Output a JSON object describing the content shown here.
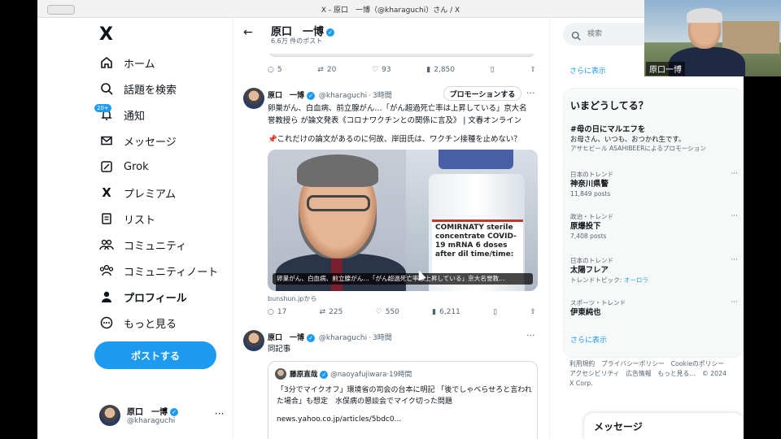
{
  "window": {
    "title": "X - 原口　一博（@kharaguchi）さん / X"
  },
  "nav": {
    "logo": "X",
    "items": [
      {
        "label": "ホーム",
        "icon": "home-icon"
      },
      {
        "label": "話題を検索",
        "icon": "search-icon"
      },
      {
        "label": "通知",
        "icon": "bell-icon",
        "badge": "20+"
      },
      {
        "label": "メッセージ",
        "icon": "mail-icon"
      },
      {
        "label": "Grok",
        "icon": "grok-icon"
      },
      {
        "label": "プレミアム",
        "icon": "x-premium-icon"
      },
      {
        "label": "リスト",
        "icon": "list-icon"
      },
      {
        "label": "コミュニティ",
        "icon": "communities-icon"
      },
      {
        "label": "コミュニティノート",
        "icon": "community-notes-icon"
      },
      {
        "label": "プロフィール",
        "icon": "profile-icon"
      },
      {
        "label": "もっと見る",
        "icon": "more-circle-icon"
      }
    ],
    "post_button": "ポストする",
    "account": {
      "name": "原口　一博",
      "handle": "@kharaguchi"
    }
  },
  "header": {
    "name": "原口　一博",
    "posts_count": "6.6万 件のポスト",
    "back": "←"
  },
  "prev_tweet_actions": {
    "replies": "5",
    "reposts": "20",
    "likes": "93",
    "views": "2,850"
  },
  "tweet1": {
    "name": "原口　一博",
    "handle": "@kharaguchi",
    "time": "3時間",
    "promote": "プロモーションする",
    "text_line1": "卵巣がん、白血病、前立腺がん…「がん超過死亡率は上昇している」京大名",
    "text_line2": "誉教授ら が論文発表《コロナワクチンとの関係に言及》 | 文春オンライン",
    "text_line3": "📌これだけの論文があるのに何故、岸田氏は、ワクチン接種を止めない？",
    "image_caption": "卵巣がん、白血病、前立腺がん…「がん超過死亡率は上昇している」京大名誉教…",
    "vial_label": "COMIRNATY sterile concentrate COVID-19 mRNA 6 doses after dil time/time:",
    "source": "bunshun.jpから",
    "actions": {
      "replies": "17",
      "reposts": "225",
      "likes": "550",
      "views": "6,211"
    }
  },
  "tweet2": {
    "name": "原口　一博",
    "handle": "@kharaguchi",
    "time": "3時間",
    "text": "同記事",
    "quote": {
      "name": "藤原直哉",
      "handle": "@naoyafujiwara",
      "time": "19時間",
      "text": "「3分でマイクオフ」環境省の司会の台本に明記 「後でしゃべらせろと言われた場合」も想定　水俣病の懇談会でマイク切った問題",
      "link": "news.yahoo.co.jp/articles/5bdc0..."
    }
  },
  "sidebar": {
    "search_placeholder": "検索",
    "show_more_top": "さらに表示",
    "trends_title": "いまどうしてる？",
    "trends": [
      {
        "category": "",
        "name": "#母の日にマルエフを",
        "count": "お母さん、いつも、おつかれ生です。",
        "extra": "アサヒビール ASAHIBEERによるプロモーション"
      },
      {
        "category": "日本のトレンド",
        "name": "神奈川県警",
        "count": "11,849 posts"
      },
      {
        "category": "政治・トレンド",
        "name": "原爆投下",
        "count": "7,408 posts"
      },
      {
        "category": "日本のトレンド",
        "name": "太陽フレア",
        "count": "トレンドトピック: ",
        "link": "オーロラ"
      },
      {
        "category": "スポーツ・トレンド",
        "name": "伊東純也",
        "count": ""
      }
    ],
    "show_more_bottom": "さらに表示",
    "footer": "利用規約　プライバシーポリシー　Cookieのポリシー　アクセシビリティ　広告情報　もっと見る…　© 2024 X Corp.",
    "messages": "メッセージ"
  },
  "video": {
    "name": "原口一博"
  },
  "watermark": "zoom"
}
